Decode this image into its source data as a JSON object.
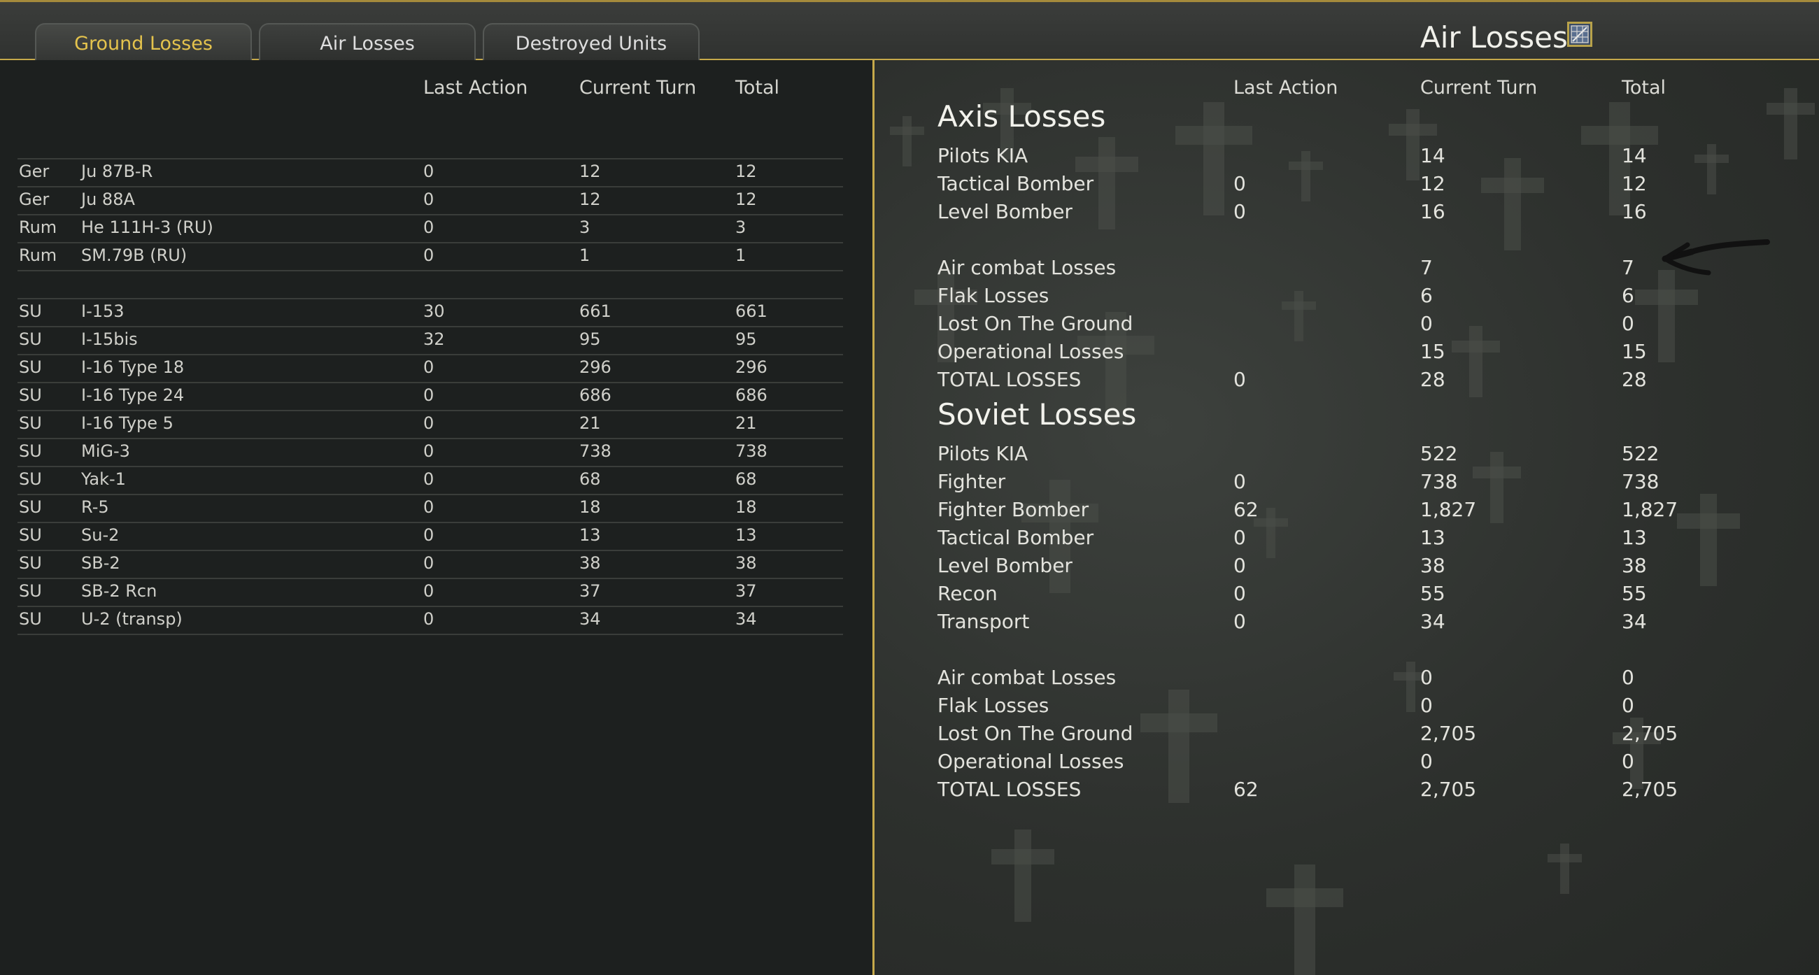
{
  "tabs": [
    {
      "label": "Ground Losses",
      "active": true
    },
    {
      "label": "Air Losses",
      "active": false
    },
    {
      "label": "Destroyed Units",
      "active": false
    }
  ],
  "panel": {
    "title": "Air Losses",
    "icon": "map-grid-icon"
  },
  "left_table": {
    "headers": [
      "Last Action",
      "Current Turn",
      "Total"
    ],
    "groups": [
      [
        {
          "nation": "Ger",
          "unit": "Ju 87B-R",
          "last": "0",
          "turn": "12",
          "total": "12"
        },
        {
          "nation": "Ger",
          "unit": "Ju 88A",
          "last": "0",
          "turn": "12",
          "total": "12"
        },
        {
          "nation": "Rum",
          "unit": "He 111H-3 (RU)",
          "last": "0",
          "turn": "3",
          "total": "3"
        },
        {
          "nation": "Rum",
          "unit": "SM.79B (RU)",
          "last": "0",
          "turn": "1",
          "total": "1"
        }
      ],
      [
        {
          "nation": "SU",
          "unit": "I-153",
          "last": "30",
          "turn": "661",
          "total": "661"
        },
        {
          "nation": "SU",
          "unit": "I-15bis",
          "last": "32",
          "turn": "95",
          "total": "95"
        },
        {
          "nation": "SU",
          "unit": "I-16 Type 18",
          "last": "0",
          "turn": "296",
          "total": "296"
        },
        {
          "nation": "SU",
          "unit": "I-16 Type 24",
          "last": "0",
          "turn": "686",
          "total": "686"
        },
        {
          "nation": "SU",
          "unit": "I-16 Type 5",
          "last": "0",
          "turn": "21",
          "total": "21"
        },
        {
          "nation": "SU",
          "unit": "MiG-3",
          "last": "0",
          "turn": "738",
          "total": "738"
        },
        {
          "nation": "SU",
          "unit": "Yak-1",
          "last": "0",
          "turn": "68",
          "total": "68"
        },
        {
          "nation": "SU",
          "unit": "R-5",
          "last": "0",
          "turn": "18",
          "total": "18"
        },
        {
          "nation": "SU",
          "unit": "Su-2",
          "last": "0",
          "turn": "13",
          "total": "13"
        },
        {
          "nation": "SU",
          "unit": "SB-2",
          "last": "0",
          "turn": "38",
          "total": "38"
        },
        {
          "nation": "SU",
          "unit": "SB-2 Rcn",
          "last": "0",
          "turn": "37",
          "total": "37"
        },
        {
          "nation": "SU",
          "unit": "U-2 (transp)",
          "last": "0",
          "turn": "34",
          "total": "34"
        }
      ]
    ]
  },
  "right_table": {
    "headers": [
      "Last Action",
      "Current Turn",
      "Total"
    ],
    "sections": [
      {
        "title": "Axis Losses",
        "blocks": [
          [
            {
              "label": "Pilots KIA",
              "last": "",
              "turn": "14",
              "total": "14"
            },
            {
              "label": "Tactical Bomber",
              "last": "0",
              "turn": "12",
              "total": "12"
            },
            {
              "label": "Level Bomber",
              "last": "0",
              "turn": "16",
              "total": "16"
            }
          ],
          [
            {
              "label": "Air combat Losses",
              "last": "",
              "turn": "7",
              "total": "7"
            },
            {
              "label": "Flak Losses",
              "last": "",
              "turn": "6",
              "total": "6"
            },
            {
              "label": "Lost On The Ground",
              "last": "",
              "turn": "0",
              "total": "0"
            },
            {
              "label": "Operational Losses",
              "last": "",
              "turn": "15",
              "total": "15"
            },
            {
              "label": "TOTAL LOSSES",
              "last": "0",
              "turn": "28",
              "total": "28"
            }
          ]
        ]
      },
      {
        "title": "Soviet Losses",
        "blocks": [
          [
            {
              "label": "Pilots KIA",
              "last": "",
              "turn": "522",
              "total": "522"
            },
            {
              "label": "Fighter",
              "last": "0",
              "turn": "738",
              "total": "738"
            },
            {
              "label": "Fighter Bomber",
              "last": "62",
              "turn": "1,827",
              "total": "1,827"
            },
            {
              "label": "Tactical Bomber",
              "last": "0",
              "turn": "13",
              "total": "13"
            },
            {
              "label": "Level Bomber",
              "last": "0",
              "turn": "38",
              "total": "38"
            },
            {
              "label": "Recon",
              "last": "0",
              "turn": "55",
              "total": "55"
            },
            {
              "label": "Transport",
              "last": "0",
              "turn": "34",
              "total": "34"
            }
          ],
          [
            {
              "label": "Air combat Losses",
              "last": "",
              "turn": "0",
              "total": "0"
            },
            {
              "label": "Flak Losses",
              "last": "",
              "turn": "0",
              "total": "0"
            },
            {
              "label": "Lost On The Ground",
              "last": "",
              "turn": "2,705",
              "total": "2,705"
            },
            {
              "label": "Operational Losses",
              "last": "",
              "turn": "0",
              "total": "0"
            },
            {
              "label": "TOTAL LOSSES",
              "last": "62",
              "turn": "2,705",
              "total": "2,705"
            }
          ]
        ]
      }
    ]
  },
  "annotation": {
    "icon": "hand-drawn-arrow-icon"
  },
  "colors": {
    "accent": "#c6a94a",
    "active_tab_text": "#e4c34d",
    "background": "#1d201f"
  }
}
